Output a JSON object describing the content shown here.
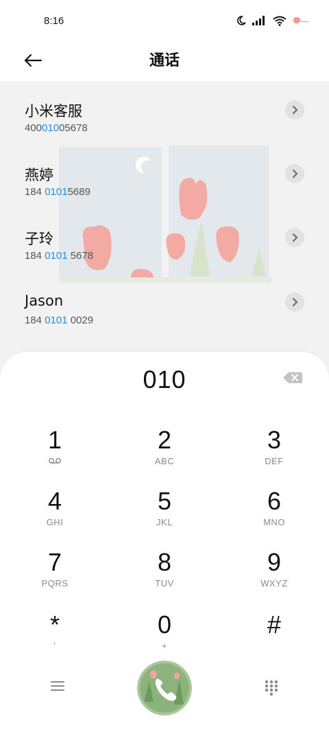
{
  "status_bar": {
    "time": "8:16",
    "icons": [
      "moon-icon",
      "signal-icon",
      "wifi-icon",
      "tulip-icon"
    ]
  },
  "header": {
    "title": "通话",
    "back_icon": "arrow-left-icon"
  },
  "contacts": [
    {
      "name": "小米客服",
      "number_pre": "400",
      "number_hl": "010",
      "number_post": "05678"
    },
    {
      "name": "燕婷",
      "number_pre": "184 ",
      "number_hl": "0101",
      "number_post": "5689"
    },
    {
      "name": "子玲",
      "number_pre": "184 ",
      "number_hl": "0101",
      "number_post": " 5678"
    },
    {
      "name": "Jason",
      "number_pre": "184 ",
      "number_hl": "0101",
      "number_post": " 0029"
    }
  ],
  "dialer": {
    "display": "010",
    "keys": [
      {
        "digit": "1",
        "letters": ""
      },
      {
        "digit": "2",
        "letters": "ABC"
      },
      {
        "digit": "3",
        "letters": "DEF"
      },
      {
        "digit": "4",
        "letters": "GHI"
      },
      {
        "digit": "5",
        "letters": "JKL"
      },
      {
        "digit": "6",
        "letters": "MNO"
      },
      {
        "digit": "7",
        "letters": "PQRS"
      },
      {
        "digit": "8",
        "letters": "TUV"
      },
      {
        "digit": "9",
        "letters": "WXYZ"
      },
      {
        "digit": "*",
        "letters": ","
      },
      {
        "digit": "0",
        "letters": "+"
      },
      {
        "digit": "#",
        "letters": ""
      }
    ]
  },
  "colors": {
    "highlight": "#1a8ee6",
    "background": "#f2f2f2",
    "panel": "#ffffff"
  }
}
